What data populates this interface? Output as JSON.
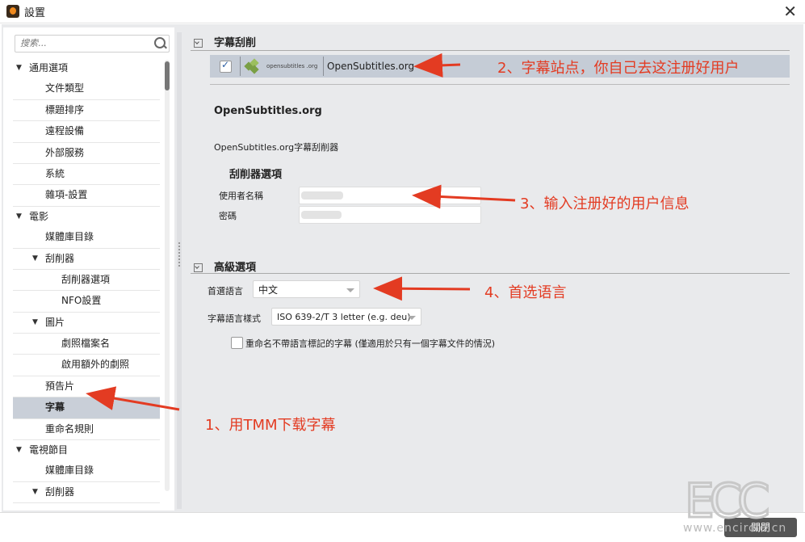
{
  "window": {
    "title": "設置",
    "close_glyph": "✕"
  },
  "search": {
    "placeholder": "搜索..."
  },
  "tree": [
    {
      "label": "通用選項",
      "level": 0,
      "expanded": true
    },
    {
      "label": "文件類型",
      "level": 1
    },
    {
      "label": "標題排序",
      "level": 1
    },
    {
      "label": "遠程設備",
      "level": 1
    },
    {
      "label": "外部服務",
      "level": 1
    },
    {
      "label": "系統",
      "level": 1
    },
    {
      "label": "雜項-設置",
      "level": 1
    },
    {
      "label": "電影",
      "level": 0,
      "expanded": true
    },
    {
      "label": "媒體庫目錄",
      "level": 1
    },
    {
      "label": "刮削器",
      "level": 1,
      "expanded": true
    },
    {
      "label": "刮削器選項",
      "level": 2
    },
    {
      "label": "NFO設置",
      "level": 2
    },
    {
      "label": "圖片",
      "level": 1,
      "expanded": true
    },
    {
      "label": "劇照檔案名",
      "level": 2
    },
    {
      "label": "啟用額外的劇照",
      "level": 2
    },
    {
      "label": "預告片",
      "level": 1
    },
    {
      "label": "字幕",
      "level": 1,
      "selected": true
    },
    {
      "label": "重命名規則",
      "level": 1
    },
    {
      "label": "電視節目",
      "level": 0,
      "expanded": true
    },
    {
      "label": "媒體庫目錄",
      "level": 1
    },
    {
      "label": "刮削器",
      "level": 1,
      "expanded": true
    }
  ],
  "subtitle_section": {
    "title": "字幕刮削",
    "site_checked": true,
    "site_logo_text": "opensubtitles .org",
    "site_name": "OpenSubtitles.org",
    "heading": "OpenSubtitles.org",
    "description": "OpenSubtitles.org字幕刮削器",
    "options_title": "刮削器選項",
    "username_label": "使用者名稱",
    "password_label": "密碼"
  },
  "advanced_section": {
    "title": "高級選項",
    "preferred_language_label": "首選語言",
    "preferred_language_value": "中文",
    "subtitle_language_style_label": "字幕語言樣式",
    "subtitle_language_style_value": "ISO 639-2/T 3 letter (e.g. deu)",
    "rename_checkbox_label": "重命名不帶語言標記的字幕 (僅適用於只有一個字幕文件的情況)",
    "rename_checked": false
  },
  "annotations": {
    "a1": "1、用TMM下载字幕",
    "a2": "2、字幕站点，你自己去这注册好用户",
    "a3": "3、输入注册好的用户信息",
    "a4": "4、首选语言",
    "color": "#e33b22"
  },
  "footer": {
    "close_label": "關閉"
  },
  "watermark": {
    "text": "www.encircle.cn",
    "logo": "ECC"
  }
}
